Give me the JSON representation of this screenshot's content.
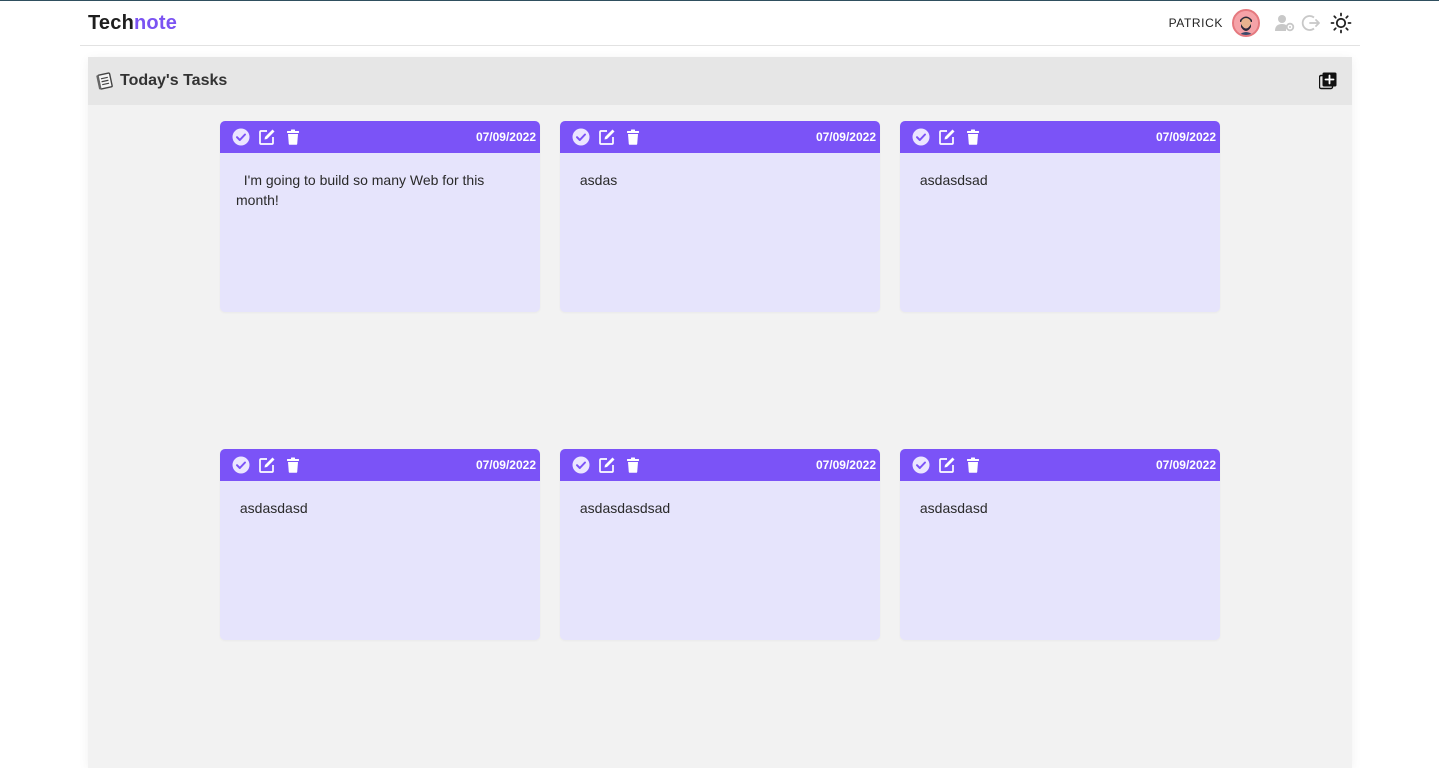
{
  "app": {
    "brand_part1": "Tech",
    "brand_part2": "note",
    "username": "PATRICK",
    "accent_color": "#7b53f7"
  },
  "header": {
    "icons": [
      "avatar",
      "user-settings-icon",
      "logout-icon",
      "theme-toggle-sun-icon"
    ]
  },
  "panel": {
    "title": "Today's Tasks",
    "title_icon": "notebook-icon",
    "add_icon": "add-note-icon"
  },
  "tasks": [
    {
      "date": "07/09/2022",
      "text": "  I'm going to build so many Web for this month!"
    },
    {
      "date": "07/09/2022",
      "text": " asdas"
    },
    {
      "date": "07/09/2022",
      "text": " asdasdsad"
    },
    {
      "date": "07/09/2022",
      "text": " asdasdasd"
    },
    {
      "date": "07/09/2022",
      "text": " asdasdasdsad"
    },
    {
      "date": "07/09/2022",
      "text": " asdasdasd"
    }
  ]
}
